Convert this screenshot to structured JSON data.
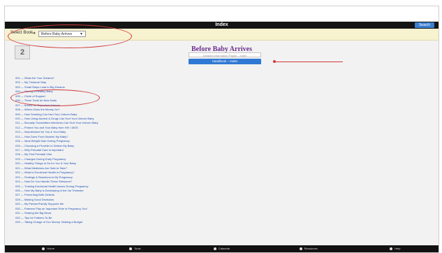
{
  "header": {
    "title": "Index",
    "search_label": "Search"
  },
  "selector": {
    "label": "Select Book",
    "arrow": "➜",
    "value": "Before Baby Arrives"
  },
  "book": {
    "icon_text": "2",
    "title": "Before Baby Arrives",
    "subtitle_placeholder": "Detailed Information Pages – Index",
    "index_button": "Handbook – Index"
  },
  "topics": [
    "001 — What Are Your Dreams?",
    "002 — My Treasure Map",
    "003 — Small Steps Lead to Big Dreams",
    "004 — Having a Healthy Baby",
    "005 — Circle of Support",
    "006 — Three Tools for New Dads",
    "007 — Advice for Expectant Fathers",
    "008 — Where Does the Money Go?",
    "009 — How Smoking Can Hurt Your Unborn Baby",
    "010 — How Using Alcohol & Drugs Can Hurt Your Unborn Baby",
    "011 — Sexually Transmitted Infections Can Hurt Your Unborn Baby",
    "012 — Protect You and Your Baby from HIV / AIDS",
    "013 — Nourishment for You & Your Baby",
    "014 — How Does Food Nourish My Baby?",
    "015 — Ideal Weight Gain During Pregnancy",
    "016 — Choosing a Provider to Deliver My Baby",
    "017 — Why Prenatal Care is Important",
    "018 — My First Prenatal Visit",
    "019 — Changes During Early Pregnancy",
    "020 — Healthy Things to Do for You & Your Baby",
    "021 — What Medicines Are Safe to Take?",
    "022 — What is Emotional Health in Pregnancy?",
    "023 — Feelings & Reactions to My Pregnancy",
    "024 — How Do You Handle These Stressors?",
    "025 — Trusting Emotional Health Issues During Pregnancy",
    "026 — How My Baby is Developing in the 1st Trimester",
    "027 — Preventing Birth Defects",
    "028 — Making Good Decisions",
    "029 — My Partner/Family Supports Me",
    "030 — Partners Play an Important Role in Pregnancy Too!",
    "031 — Sharing the Big News",
    "032 — Tips for Fathers-To-Be",
    "033 — Taking Charge of Our Money: Making a Budget"
  ],
  "footer": {
    "tabs": [
      {
        "label": "Home",
        "icon": "home-icon"
      },
      {
        "label": "Tools",
        "icon": "tools-icon"
      },
      {
        "label": "Calendar",
        "icon": "calendar-icon"
      },
      {
        "label": "Resources",
        "icon": "resources-icon"
      },
      {
        "label": "Help",
        "icon": "help-icon"
      }
    ]
  },
  "colors": {
    "topbar": "#141414",
    "select_bar": "#f7f2cf",
    "title": "#6a2c8c",
    "link": "#1d4fb5",
    "button": "#2f78d3",
    "annotation": "#d23a3a"
  }
}
